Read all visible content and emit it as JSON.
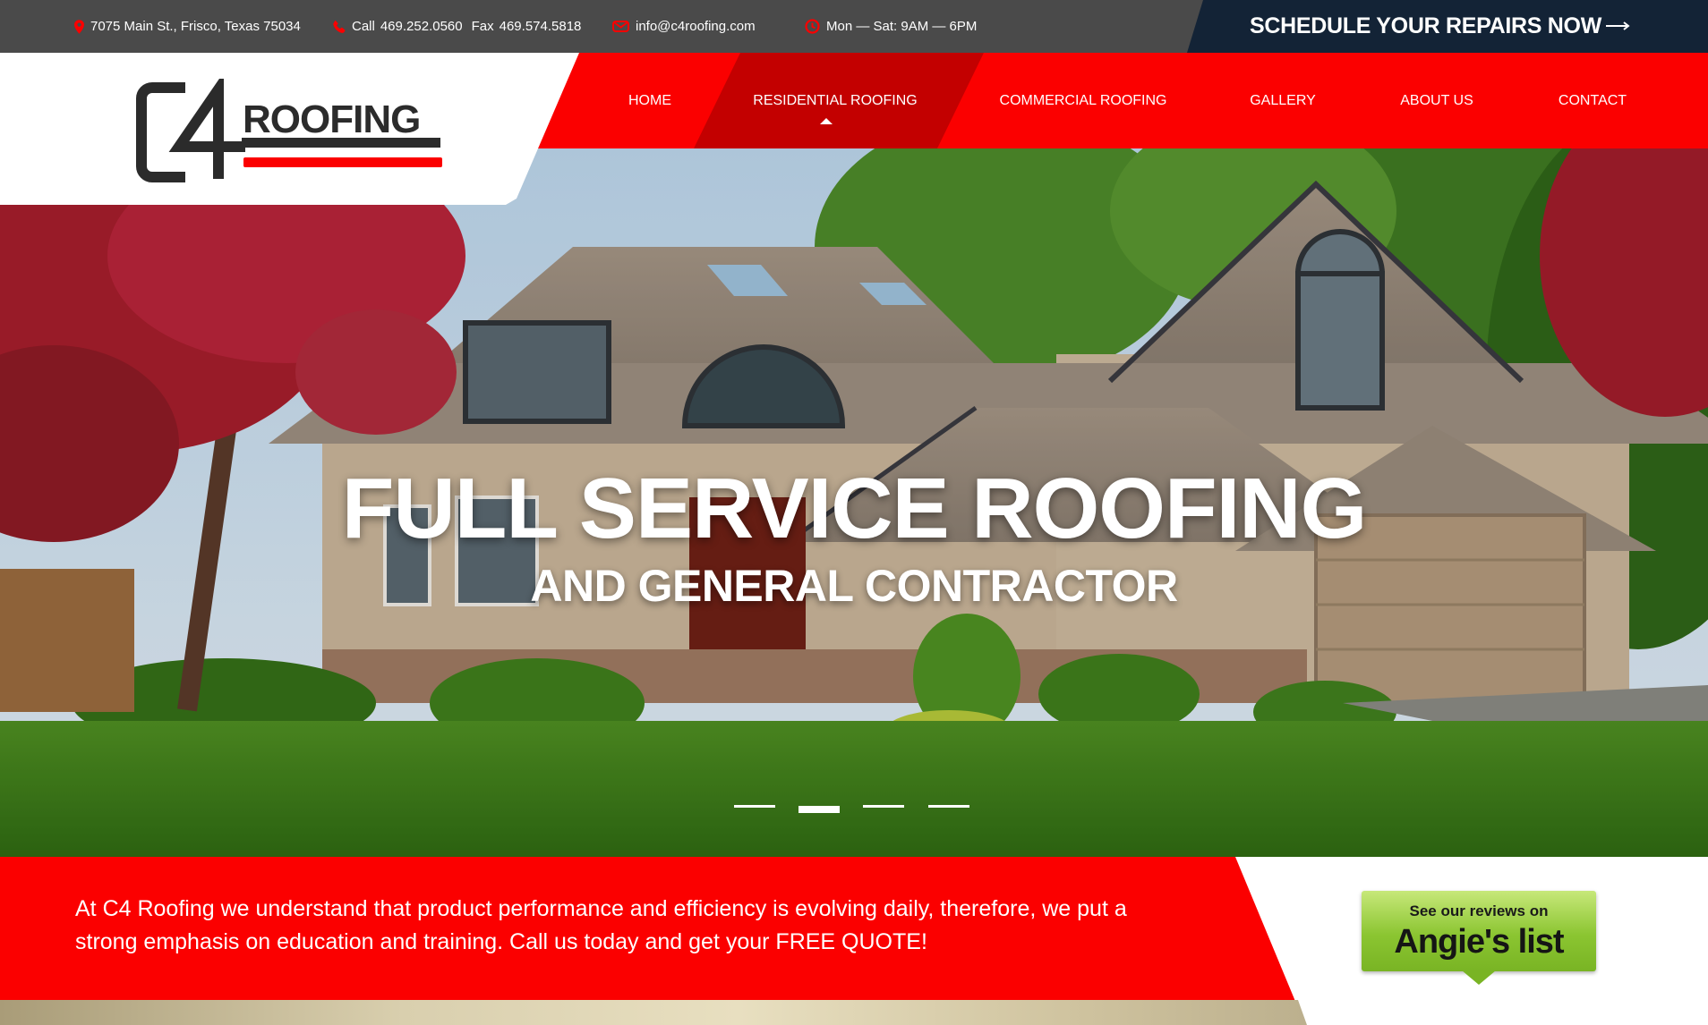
{
  "topbar": {
    "address": "7075 Main St., Frisco, Texas 75034",
    "call_label": "Call",
    "phone": "469.252.0560",
    "fax_label": "Fax",
    "fax": "469.574.5818",
    "email": "info@c4roofing.com",
    "hours": "Mon — Sat: 9AM — 6PM",
    "schedule_cta": "SCHEDULE YOUR REPAIRS NOW"
  },
  "nav": {
    "items": [
      {
        "label": "HOME"
      },
      {
        "label": "RESIDENTIAL ROOFING"
      },
      {
        "label": "COMMERCIAL ROOFING"
      },
      {
        "label": "GALLERY"
      },
      {
        "label": "ABOUT US"
      },
      {
        "label": "CONTACT"
      }
    ],
    "active": "RESIDENTIAL ROOFING"
  },
  "logo": {
    "text": "ROOFING",
    "mark": "C4"
  },
  "hero": {
    "title": "FULL SERVICE ROOFING",
    "subtitle": "AND GENERAL CONTRACTOR",
    "slides": 4,
    "active_slide": 2
  },
  "band": {
    "text": "At C4 Roofing we understand that product performance and efficiency is evolving daily, therefore, we put a strong emphasis on education and training. Call us today and get your FREE QUOTE!",
    "badge_line1": "See our reviews on",
    "badge_line2": "Angie's list"
  },
  "colors": {
    "brand_red": "#fb0000",
    "active_red": "#c30000",
    "topbar": "#4a4a4a",
    "cta_navy": "#132336",
    "badge_green": "#8bc531"
  },
  "icons": [
    "location-pin-icon",
    "phone-icon",
    "email-icon",
    "clock-icon",
    "arrow-right-icon",
    "caret-up-icon"
  ]
}
